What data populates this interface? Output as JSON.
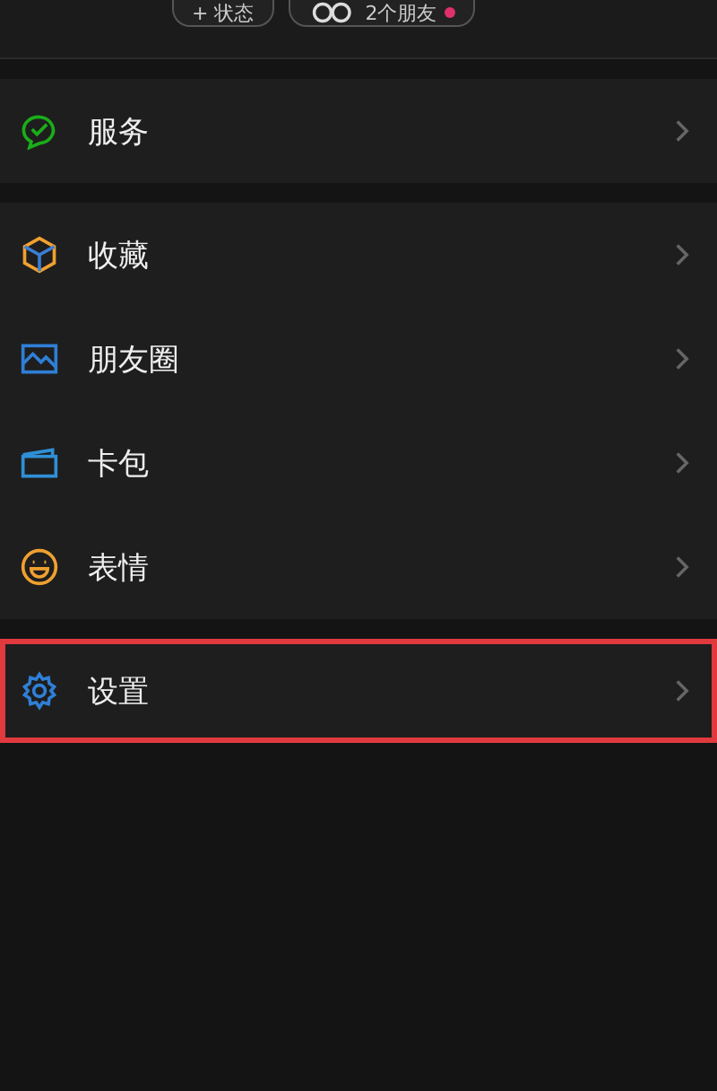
{
  "header": {
    "status_button": "+ 状态",
    "friends_button": {
      "label": "2个朋友",
      "badge": true
    }
  },
  "groups": [
    {
      "items": [
        {
          "label": "服务",
          "kind": "service",
          "highlighted": false
        }
      ]
    },
    {
      "items": [
        {
          "label": "收藏",
          "kind": "favorites",
          "highlighted": false
        },
        {
          "label": "朋友圈",
          "kind": "moments",
          "highlighted": false
        },
        {
          "label": "卡包",
          "kind": "cards",
          "highlighted": false
        },
        {
          "label": "表情",
          "kind": "stickers",
          "highlighted": false
        }
      ]
    },
    {
      "items": [
        {
          "label": "设置",
          "kind": "settings",
          "highlighted": true
        }
      ]
    }
  ]
}
